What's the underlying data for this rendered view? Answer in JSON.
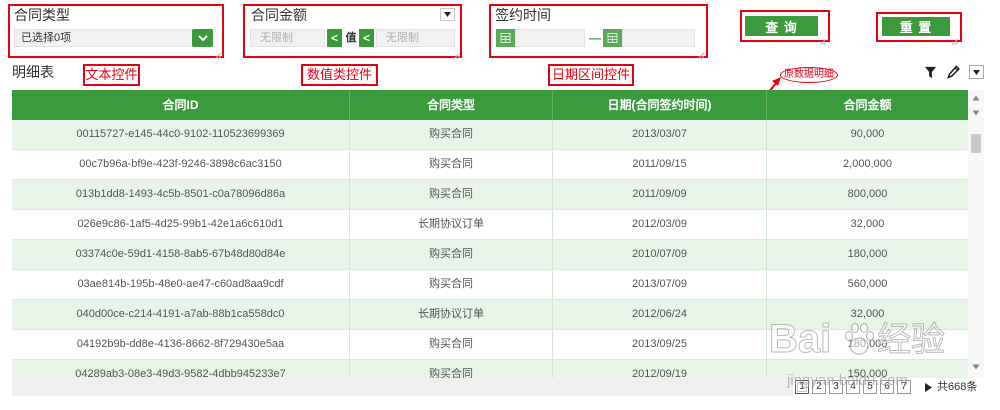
{
  "filters": {
    "contract_type": {
      "label": "合同类型",
      "selected_text": "已选择0项",
      "toggle_icon": "chevron-down-icon"
    },
    "contract_amount": {
      "label": "合同金额",
      "options_icon": "caret-down-icon",
      "min_placeholder": "无限制",
      "min_operator": "<",
      "value_label": "值",
      "max_operator": "<",
      "max_placeholder": "无限制"
    },
    "sign_date": {
      "label": "签约时间",
      "start_icon": "calendar-icon",
      "separator": "—",
      "end_icon": "calendar-icon"
    }
  },
  "actions": {
    "query_label": "查 询",
    "reset_label": "重 置"
  },
  "annotations": {
    "text_control": "文本控件",
    "numeric_control": "数值类控件",
    "date_range_control": "日期区间控件",
    "raw_detail": "原数据明细"
  },
  "detail": {
    "title": "明细表",
    "tool_icons": [
      "filter-icon",
      "pen-icon",
      "caret-down-icon"
    ],
    "columns": [
      "合同ID",
      "合同类型",
      "日期(合同签约时间)",
      "合同金额"
    ],
    "rows": [
      {
        "id": "00115727-e145-44c0-9102-110523699369",
        "type": "购买合同",
        "date": "2013/03/07",
        "amount": "90,000"
      },
      {
        "id": "00c7b96a-bf9e-423f-9246-3898c6ac3150",
        "type": "购买合同",
        "date": "2011/09/15",
        "amount": "2,000,000"
      },
      {
        "id": "013b1dd8-1493-4c5b-8501-c0a78096d86a",
        "type": "购买合同",
        "date": "2011/09/09",
        "amount": "800,000"
      },
      {
        "id": "026e9c86-1af5-4d25-99b1-42e1a6c610d1",
        "type": "长期协议订单",
        "date": "2012/03/09",
        "amount": "32,000"
      },
      {
        "id": "03374c0e-59d1-4158-8ab5-67b48d80d84e",
        "type": "购买合同",
        "date": "2010/07/09",
        "amount": "180,000"
      },
      {
        "id": "03ae814b-195b-48e0-ae47-c60ad8aa9cdf",
        "type": "购买合同",
        "date": "2013/07/09",
        "amount": "560,000"
      },
      {
        "id": "040d00ce-c214-4191-a7ab-88b1ca558dc0",
        "type": "长期协议订单",
        "date": "2012/06/24",
        "amount": "32,000"
      },
      {
        "id": "04192b9b-dd8e-4136-8662-8f729430e5aa",
        "type": "购买合同",
        "date": "2013/09/25",
        "amount": "180,000"
      },
      {
        "id": "04289ab3-08e3-49d3-9582-4dbb945233e7",
        "type": "购买合同",
        "date": "2012/09/19",
        "amount": "150,000"
      }
    ]
  },
  "scrollbar_icons": [
    "triangle-up-icon",
    "triangle-down-icon"
  ],
  "pagination": {
    "pages": [
      {
        "label": "1",
        "current": true
      },
      {
        "label": "2",
        "current": false
      },
      {
        "label": "3",
        "current": false
      },
      {
        "label": "4",
        "current": false
      },
      {
        "label": "5",
        "current": false
      },
      {
        "label": "6",
        "current": false
      },
      {
        "label": "7",
        "current": false
      }
    ],
    "next_icon": "triangle-right-icon",
    "total": "共668条"
  },
  "watermark": {
    "brand_latin": "Bai",
    "brand_icon": "paw-icon",
    "brand_cn": "经验",
    "domain": "jingyan.baidu.com"
  },
  "colors": {
    "accent_green": "#3a9a3c",
    "row_tint": "#e8f4e8",
    "annotation_red": "#e60012"
  }
}
